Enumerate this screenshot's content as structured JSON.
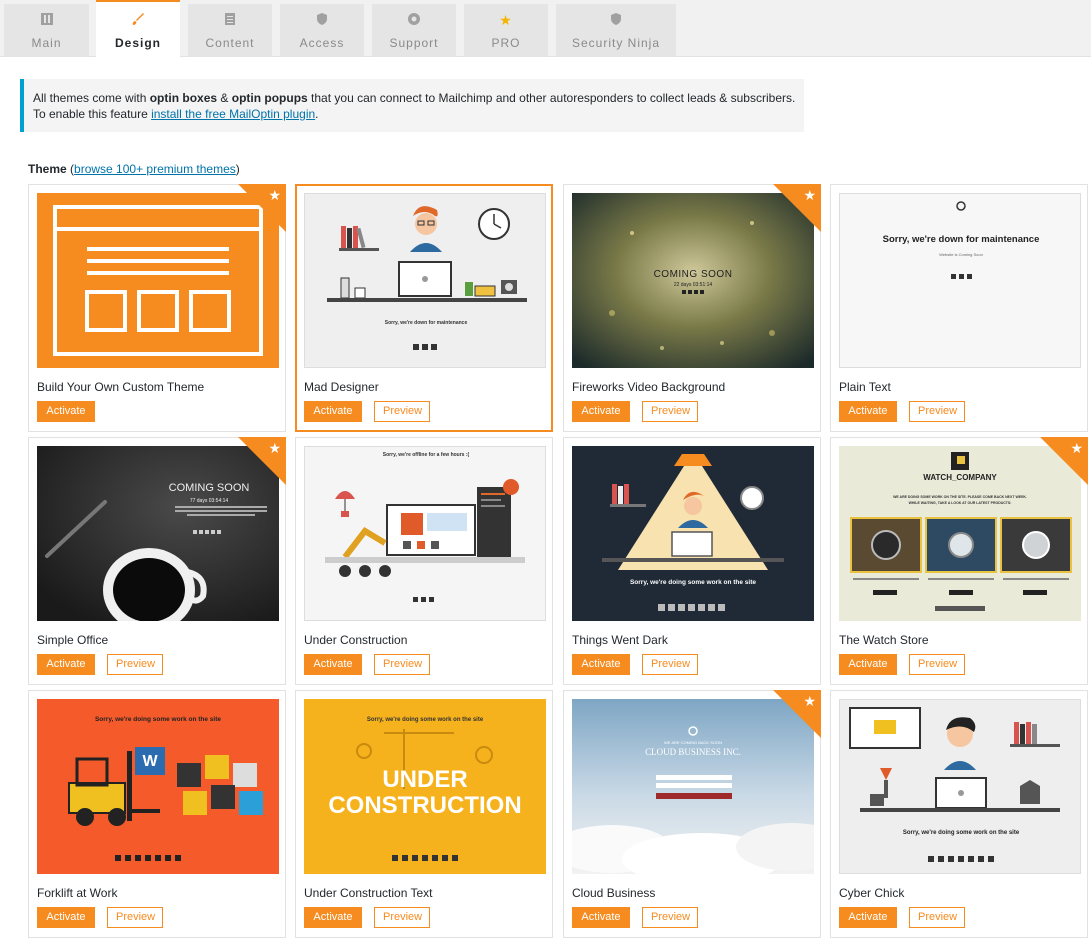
{
  "tabs": [
    {
      "label": "Main",
      "icon": "settings-sliders-icon"
    },
    {
      "label": "Design",
      "icon": "paintbrush-icon",
      "active": true
    },
    {
      "label": "Content",
      "icon": "document-icon"
    },
    {
      "label": "Access",
      "icon": "shield-icon"
    },
    {
      "label": "Support",
      "icon": "lifebuoy-icon"
    },
    {
      "label": "PRO",
      "icon": "star-icon"
    },
    {
      "label": "Security Ninja",
      "icon": "shield-icon"
    }
  ],
  "notice": {
    "line1_pre": "All themes come with ",
    "line1_b1": "optin boxes",
    "line1_mid": " & ",
    "line1_b2": "optin popups",
    "line1_post": " that you can connect to Mailchimp and other autoresponders to collect leads & subscribers.",
    "line2_pre": "To enable this feature ",
    "line2_link": "install the free MailOptin plugin",
    "line2_post": "."
  },
  "theme_section": {
    "label": "Theme",
    "open_paren": " (",
    "link": "browse 100+ premium themes",
    "close_paren": ")"
  },
  "buttons": {
    "activate": "Activate",
    "preview": "Preview"
  },
  "themes": [
    {
      "name": "Build Your Own Custom Theme",
      "premium": true,
      "preview": false
    },
    {
      "name": "Mad Designer",
      "premium": false,
      "preview": true,
      "selected": true
    },
    {
      "name": "Fireworks Video Background",
      "premium": true,
      "preview": true
    },
    {
      "name": "Plain Text",
      "premium": false,
      "preview": true
    },
    {
      "name": "Simple Office",
      "premium": true,
      "preview": true
    },
    {
      "name": "Under Construction",
      "premium": false,
      "preview": true
    },
    {
      "name": "Things Went Dark",
      "premium": false,
      "preview": true
    },
    {
      "name": "The Watch Store",
      "premium": true,
      "preview": true
    },
    {
      "name": "Forklift at Work",
      "premium": false,
      "preview": true
    },
    {
      "name": "Under Construction Text",
      "premium": false,
      "preview": true
    },
    {
      "name": "Cloud Business",
      "premium": true,
      "preview": true
    },
    {
      "name": "Cyber Chick",
      "premium": false,
      "preview": true
    }
  ],
  "thumb_text": {
    "maintenance_small": "Sorry, we're down for maintenance",
    "fireworks_title": "COMING SOON",
    "fireworks_timer": "22 days 03:51:14",
    "plain_title": "Sorry, we're down for maintenance",
    "plain_sub": "Website is Coming Soon",
    "office_title": "COMING SOON",
    "office_timer": "77 days 03:54:14",
    "construction_title": "Sorry, we're offline for a few hours :(",
    "dark_title": "Sorry, we're doing some work on the site",
    "watch_brand": "WATCH_COMPANY",
    "watch_line1": "WE ARE DOING SOME WORK ON THE SITE. PLEASE COME BACK NEXT WEEK.",
    "watch_line2": "WHILE WAITING, TAKE A LOOK AT OUR LATEST PRODUCTS:",
    "forklift_title": "Sorry, we're doing some work on the site",
    "uct_title": "Sorry, we're doing some work on the site",
    "uct_big1": "UNDER",
    "uct_big2": "CONSTRUCTION",
    "cloud_small": "WE ARE COMING BACK SOON",
    "cloud_title": "CLOUD BUSINESS INC.",
    "cyber_title": "Sorry, we're doing some work on the site"
  },
  "colors": {
    "accent": "#f68b1f",
    "link": "#0073aa",
    "notice_border": "#00a0d2"
  }
}
